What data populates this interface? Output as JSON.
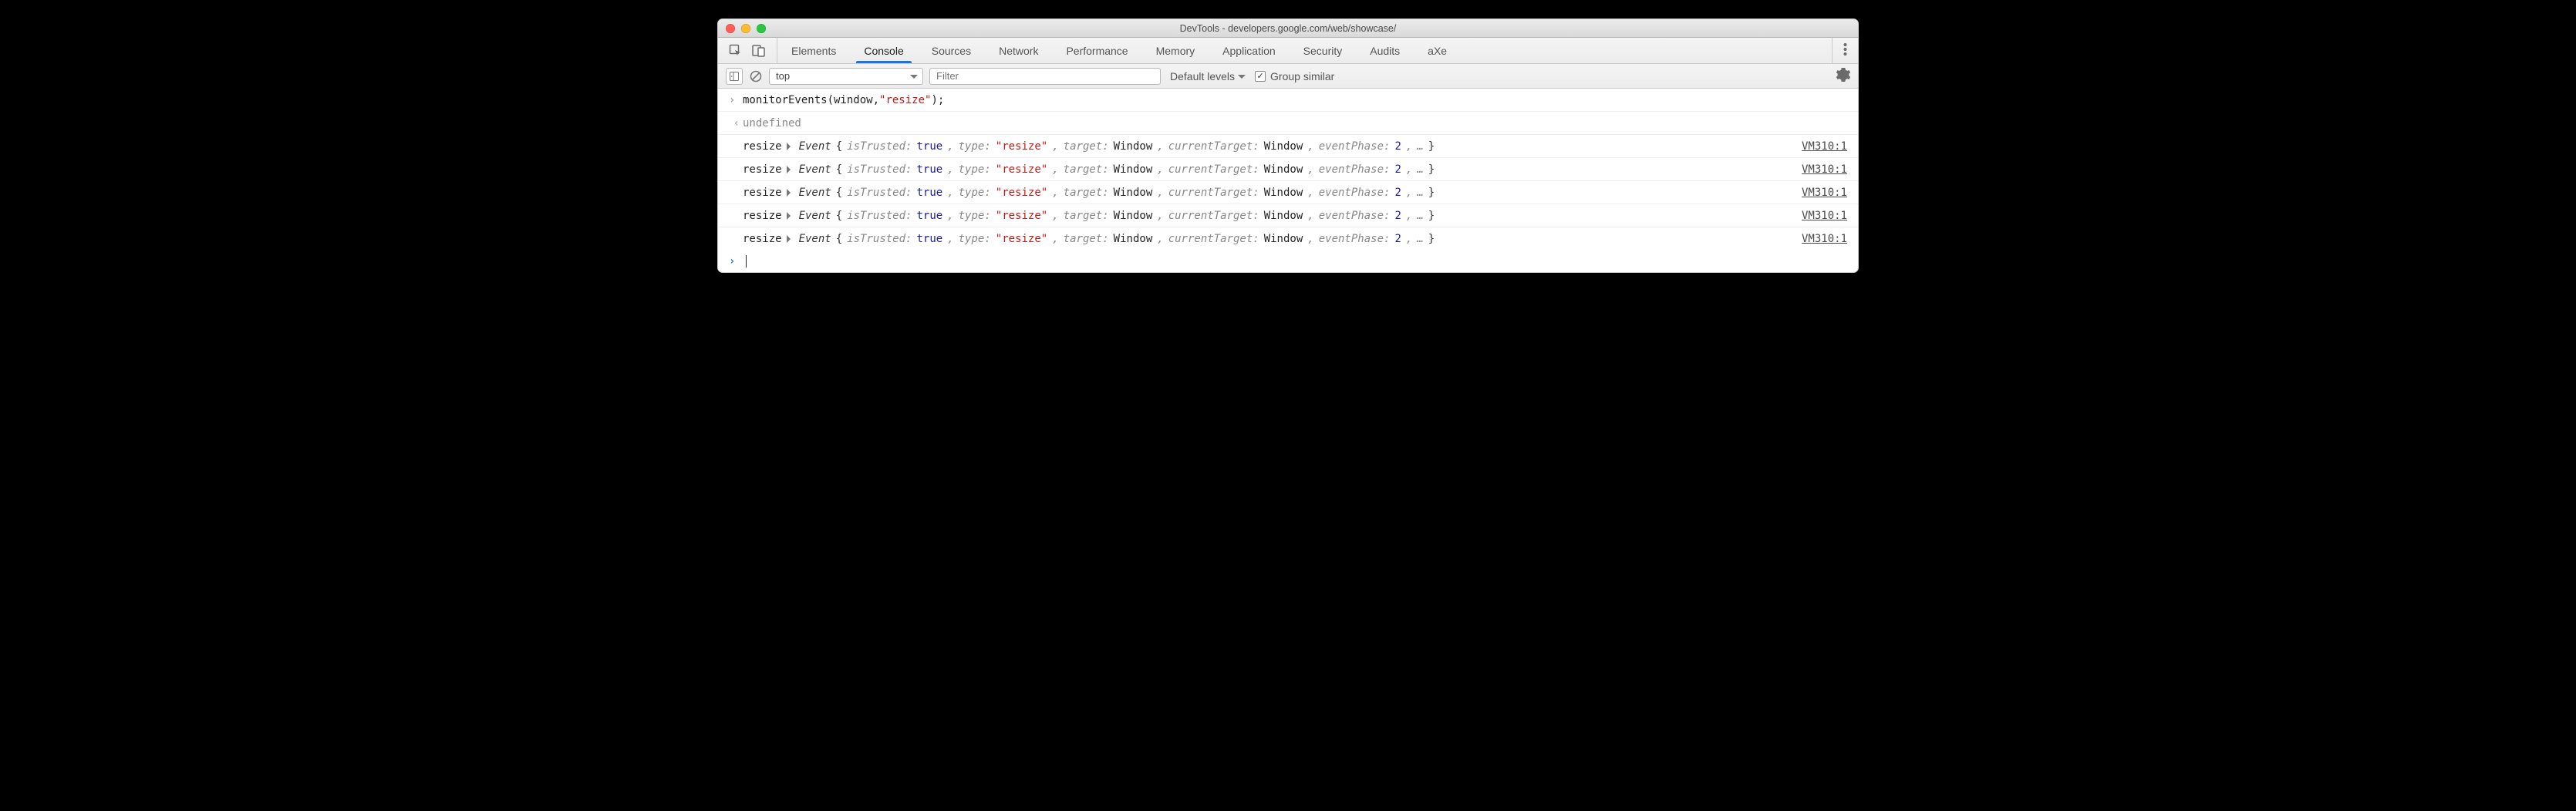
{
  "window": {
    "title": "DevTools - developers.google.com/web/showcase/"
  },
  "tabs": {
    "items": [
      {
        "label": "Elements"
      },
      {
        "label": "Console"
      },
      {
        "label": "Sources"
      },
      {
        "label": "Network"
      },
      {
        "label": "Performance"
      },
      {
        "label": "Memory"
      },
      {
        "label": "Application"
      },
      {
        "label": "Security"
      },
      {
        "label": "Audits"
      },
      {
        "label": "aXe"
      }
    ],
    "activeIndex": 1
  },
  "consoleToolbar": {
    "context": "top",
    "filter_placeholder": "Filter",
    "levels": "Default levels",
    "group_label": "Group similar",
    "group_checked": true
  },
  "input": {
    "code_pre": "monitorEvents(window, ",
    "code_str": "\"resize\"",
    "code_post": ");"
  },
  "return": {
    "value": "undefined"
  },
  "eventTemplate": {
    "label": "resize",
    "ctor": "Event",
    "k_isTrusted": "isTrusted:",
    "v_isTrusted": "true",
    "k_type": "type:",
    "v_type": "\"resize\"",
    "k_target": "target:",
    "v_target": "Window",
    "k_currentTarget": "currentTarget:",
    "v_currentTarget": "Window",
    "k_eventPhase": "eventPhase:",
    "v_eventPhase": "2",
    "ellipsis": "…",
    "source": "VM310:1"
  },
  "eventCount": 5
}
